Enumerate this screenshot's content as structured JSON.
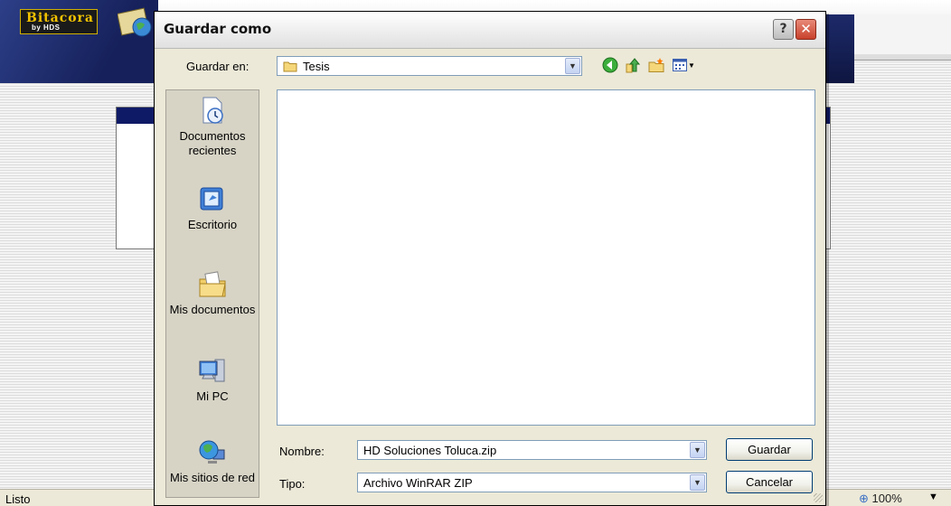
{
  "background_app": {
    "logo_text": "Bitacora",
    "logo_sub": "by HDS",
    "status_text": "Listo",
    "zoom_text": "100%"
  },
  "dialog": {
    "title": "Guardar como",
    "help_glyph": "?",
    "close_glyph": "✕",
    "save_in_label": "Guardar en:",
    "save_in_value": "Tesis",
    "places": [
      {
        "label": "Documentos recientes",
        "icon": "recent-documents-icon"
      },
      {
        "label": "Escritorio",
        "icon": "desktop-icon"
      },
      {
        "label": "Mis documentos",
        "icon": "my-documents-icon"
      },
      {
        "label": "Mi PC",
        "icon": "my-computer-icon"
      },
      {
        "label": "Mis sitios de red",
        "icon": "network-places-icon"
      }
    ],
    "name_label": "Nombre:",
    "name_value": "HD Soluciones Toluca.zip",
    "type_label": "Tipo:",
    "type_value": "Archivo WinRAR ZIP",
    "save_button": "Guardar",
    "cancel_button": "Cancelar"
  },
  "colors": {
    "dialog_face": "#ece9d8",
    "title_bar_header": "#0f1a66",
    "field_border": "#7f9db9",
    "close_red": "#c8412c"
  }
}
